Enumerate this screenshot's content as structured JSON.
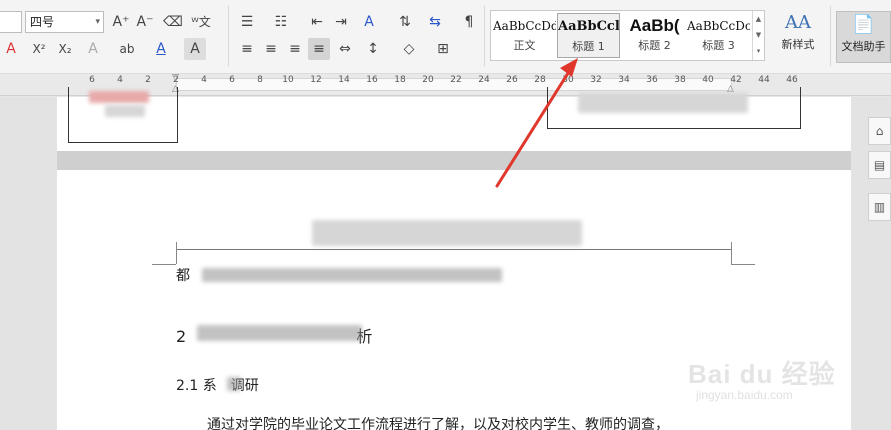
{
  "toolbar": {
    "font_size": "四号",
    "font_size_dropdown": "▾",
    "buttons": {
      "grow_font": "A⁺",
      "shrink_font": "A⁻",
      "clear_format": "⌫",
      "phonetic": "ᵂ文",
      "font_color_a": "A",
      "superscript": "X²",
      "subscript": "X₂",
      "text_effect": "A",
      "highlight": "ab",
      "font_color": "A",
      "char_shading": "A",
      "bullets": "☰",
      "numbering": "☷",
      "outdent": "⇤",
      "indent": "⇥",
      "text_direction": "A",
      "sort": "⇅",
      "line_spacing_tool": "⇆",
      "show_marks": "¶",
      "align_left": "≡",
      "align_center": "≡",
      "align_right": "≡",
      "justify": "≡",
      "distribute": "⇔",
      "line_spacing": "↕",
      "shading": "◇",
      "borders": "⊞"
    }
  },
  "style_gallery": {
    "styles": [
      {
        "sample": "AaBbCcDd",
        "name": "正文"
      },
      {
        "sample": "AaBbCcl",
        "name": "标题 1"
      },
      {
        "sample": "AaBb(",
        "name": "标题 2"
      },
      {
        "sample": "AaBbCcDc",
        "name": "标题 3"
      }
    ],
    "scroll_up": "▲",
    "scroll_down": "▼",
    "expand": "▾"
  },
  "new_style": {
    "icon": "AA",
    "label": "新样式",
    "caret": "▾"
  },
  "doc_assistant": {
    "icon": "📄",
    "label": "文档助手"
  },
  "ruler": {
    "ticks": [
      "6",
      "4",
      "2",
      "2",
      "4",
      "6",
      "8",
      "10",
      "12",
      "14",
      "16",
      "18",
      "20",
      "22",
      "24",
      "26",
      "28",
      "30",
      "32",
      "34",
      "36",
      "38",
      "40",
      "42",
      "44",
      "46"
    ]
  },
  "document": {
    "line_1_prefix": "都",
    "heading_2_prefix": "2",
    "heading_2_suffix": "析",
    "heading_21_prefix": "2.1 系",
    "heading_21_suffix": "调研",
    "paragraph": "通过对学院的毕业论文工作流程进行了解，以及对校内学生、教师的调查，"
  },
  "side_panel": {
    "btn1": "⌂",
    "btn2": "▤",
    "btn3": "▥"
  },
  "watermark": {
    "text": "Bai du 经验",
    "sub": "jingyan.baidu.com"
  },
  "colors": {
    "arrow": "#e0362c",
    "accent": "#3c6fb4"
  }
}
